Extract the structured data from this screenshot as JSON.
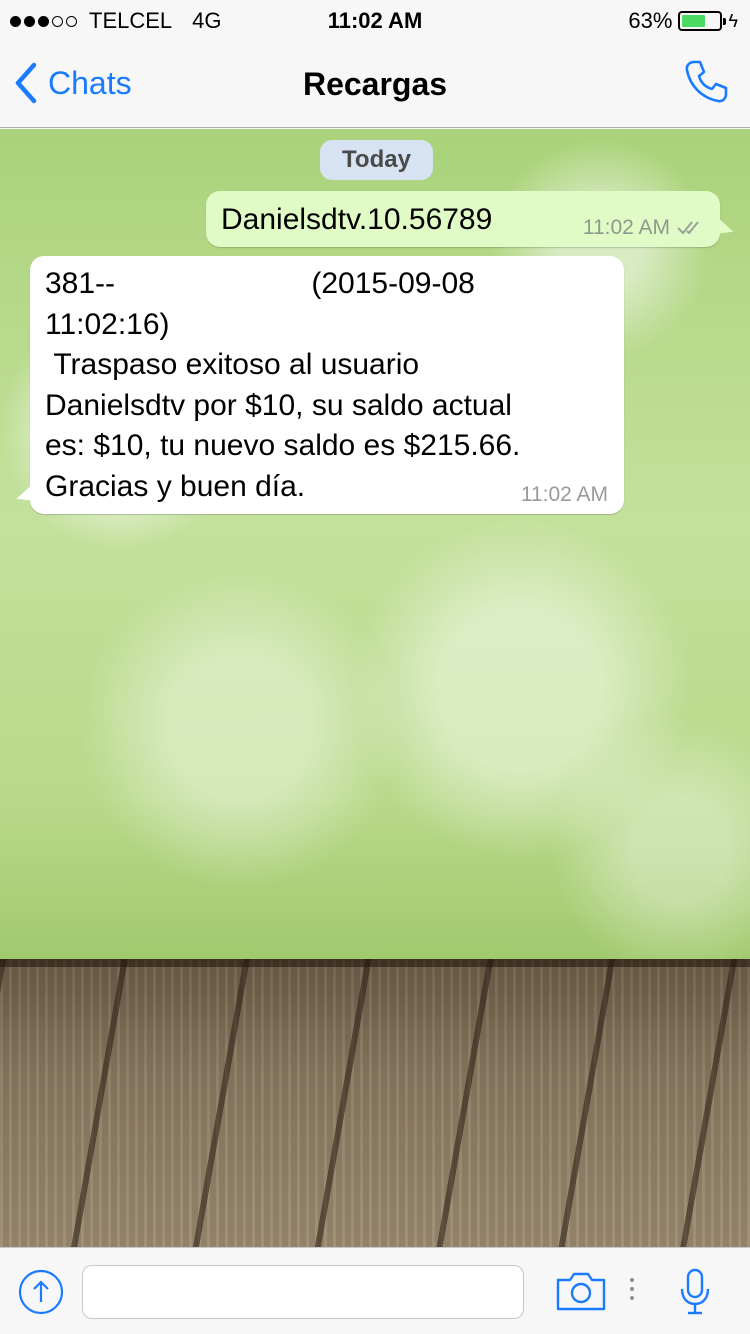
{
  "status_bar": {
    "carrier": "TELCEL",
    "network": "4G",
    "time": "11:02 AM",
    "battery_percent": "63%",
    "battery_level": 0.63,
    "signal_bars_filled": 3,
    "signal_bars_total": 5
  },
  "nav": {
    "back_label": "Chats",
    "title": "Recargas",
    "icons": {
      "back": "chevron-left-icon",
      "call": "phone-icon"
    }
  },
  "chat": {
    "date_separator": "Today",
    "messages": [
      {
        "direction": "outgoing",
        "text": "Danielsdtv.10.56789",
        "time": "11:02 AM",
        "status_icon": "double-check-icon"
      },
      {
        "direction": "incoming",
        "text_prefix": "381--",
        "text_body": " (2015-09-08\n11:02:16)\n Traspaso exitoso al usuario\nDanielsdtv por $10, su saldo actual\nes: $10, tu nuevo saldo es $215.66.\nGracias y buen día.",
        "time": "11:02 AM"
      }
    ]
  },
  "input_bar": {
    "placeholder": "",
    "icons": {
      "upload": "upload-icon",
      "camera": "camera-icon",
      "more": "more-dots-icon",
      "mic": "microphone-icon"
    }
  },
  "colors": {
    "accent": "#1a7bff",
    "outgoing_bubble": "#e1fbc6",
    "incoming_bubble": "#ffffff",
    "battery": "#4cd964"
  }
}
